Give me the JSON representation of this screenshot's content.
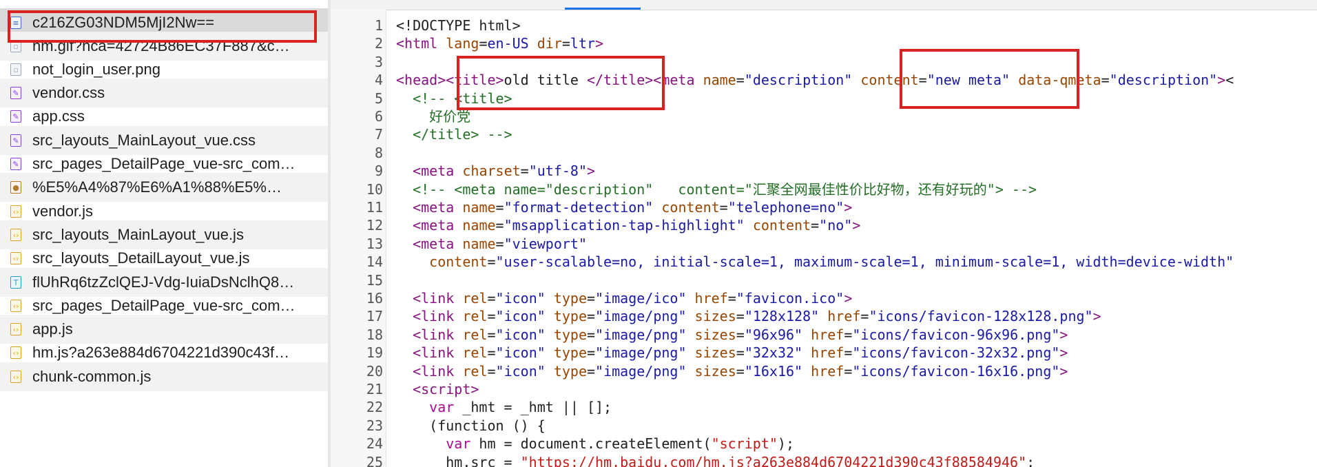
{
  "files": [
    {
      "name": "c216ZG03NDM5MjI2Nw==",
      "icon": "document-icon",
      "selected": true
    },
    {
      "name": "hm.gif?hca=42724B86EC37F887&c…",
      "icon": "image-icon"
    },
    {
      "name": "not_login_user.png",
      "icon": "image-icon"
    },
    {
      "name": "vendor.css",
      "icon": "stylesheet-icon"
    },
    {
      "name": "app.css",
      "icon": "stylesheet-icon"
    },
    {
      "name": "src_layouts_MainLayout_vue.css",
      "icon": "stylesheet-icon"
    },
    {
      "name": "src_pages_DetailPage_vue-src_com…",
      "icon": "stylesheet-icon"
    },
    {
      "name": "%E5%A4%87%E6%A1%88%E5%…",
      "icon": "badge-image-icon"
    },
    {
      "name": "vendor.js",
      "icon": "script-icon"
    },
    {
      "name": "src_layouts_MainLayout_vue.js",
      "icon": "script-icon"
    },
    {
      "name": "src_layouts_DetailLayout_vue.js",
      "icon": "script-icon"
    },
    {
      "name": "flUhRq6tzZclQEJ-Vdg-IuiaDsNclhQ8…",
      "icon": "font-icon"
    },
    {
      "name": "src_pages_DetailPage_vue-src_com…",
      "icon": "script-icon"
    },
    {
      "name": "app.js",
      "icon": "script-icon"
    },
    {
      "name": "hm.js?a263e884d6704221d390c43f…",
      "icon": "script-icon"
    },
    {
      "name": "chunk-common.js",
      "icon": "script-icon"
    }
  ],
  "code_lines": [
    [
      [
        "pl",
        "<!DOCTYPE html>"
      ]
    ],
    [
      [
        "tg",
        "<html"
      ],
      [
        "pl",
        " "
      ],
      [
        "an",
        "lang"
      ],
      [
        "pl",
        "="
      ],
      [
        "av",
        "en-US"
      ],
      [
        "pl",
        " "
      ],
      [
        "an",
        "dir"
      ],
      [
        "pl",
        "="
      ],
      [
        "av",
        "ltr"
      ],
      [
        "tg",
        ">"
      ]
    ],
    [],
    [
      [
        "tg",
        "<head>"
      ],
      [
        "tg",
        "<title>"
      ],
      [
        "pl",
        "old title "
      ],
      [
        "tg",
        "</title>"
      ],
      [
        "tg",
        "<meta"
      ],
      [
        "pl",
        " "
      ],
      [
        "an",
        "name"
      ],
      [
        "pl",
        "="
      ],
      [
        "av",
        "\"description\""
      ],
      [
        "pl",
        " "
      ],
      [
        "an",
        "content"
      ],
      [
        "pl",
        "="
      ],
      [
        "av",
        "\"new meta\""
      ],
      [
        "pl",
        " "
      ],
      [
        "an",
        "data-qmeta"
      ],
      [
        "pl",
        "="
      ],
      [
        "av",
        "\"description\""
      ],
      [
        "tg",
        ">"
      ],
      [
        "pl",
        "<"
      ]
    ],
    [
      [
        "pl",
        "  "
      ],
      [
        "cm",
        "<!-- <title>"
      ]
    ],
    [
      [
        "cm",
        "    好价党"
      ]
    ],
    [
      [
        "cm",
        "  </title> -->"
      ]
    ],
    [],
    [
      [
        "pl",
        "  "
      ],
      [
        "tg",
        "<meta"
      ],
      [
        "pl",
        " "
      ],
      [
        "an",
        "charset"
      ],
      [
        "pl",
        "="
      ],
      [
        "av",
        "\"utf-8\""
      ],
      [
        "tg",
        ">"
      ]
    ],
    [
      [
        "pl",
        "  "
      ],
      [
        "cm",
        "<!-- <meta name=\"description\"   content=\"汇聚全网最佳性价比好物，还有好玩的\"> -->"
      ]
    ],
    [
      [
        "pl",
        "  "
      ],
      [
        "tg",
        "<meta"
      ],
      [
        "pl",
        " "
      ],
      [
        "an",
        "name"
      ],
      [
        "pl",
        "="
      ],
      [
        "av",
        "\"format-detection\""
      ],
      [
        "pl",
        " "
      ],
      [
        "an",
        "content"
      ],
      [
        "pl",
        "="
      ],
      [
        "av",
        "\"telephone=no\""
      ],
      [
        "tg",
        ">"
      ]
    ],
    [
      [
        "pl",
        "  "
      ],
      [
        "tg",
        "<meta"
      ],
      [
        "pl",
        " "
      ],
      [
        "an",
        "name"
      ],
      [
        "pl",
        "="
      ],
      [
        "av",
        "\"msapplication-tap-highlight\""
      ],
      [
        "pl",
        " "
      ],
      [
        "an",
        "content"
      ],
      [
        "pl",
        "="
      ],
      [
        "av",
        "\"no\""
      ],
      [
        "tg",
        ">"
      ]
    ],
    [
      [
        "pl",
        "  "
      ],
      [
        "tg",
        "<meta"
      ],
      [
        "pl",
        " "
      ],
      [
        "an",
        "name"
      ],
      [
        "pl",
        "="
      ],
      [
        "av",
        "\"viewport\""
      ]
    ],
    [
      [
        "pl",
        "    "
      ],
      [
        "an",
        "content"
      ],
      [
        "pl",
        "="
      ],
      [
        "av",
        "\"user-scalable=no, initial-scale=1, maximum-scale=1, minimum-scale=1, width=device-width\""
      ]
    ],
    [],
    [
      [
        "pl",
        "  "
      ],
      [
        "tg",
        "<link"
      ],
      [
        "pl",
        " "
      ],
      [
        "an",
        "rel"
      ],
      [
        "pl",
        "="
      ],
      [
        "av",
        "\"icon\""
      ],
      [
        "pl",
        " "
      ],
      [
        "an",
        "type"
      ],
      [
        "pl",
        "="
      ],
      [
        "av",
        "\"image/ico\""
      ],
      [
        "pl",
        " "
      ],
      [
        "an",
        "href"
      ],
      [
        "pl",
        "="
      ],
      [
        "av",
        "\"favicon.ico\""
      ],
      [
        "tg",
        ">"
      ]
    ],
    [
      [
        "pl",
        "  "
      ],
      [
        "tg",
        "<link"
      ],
      [
        "pl",
        " "
      ],
      [
        "an",
        "rel"
      ],
      [
        "pl",
        "="
      ],
      [
        "av",
        "\"icon\""
      ],
      [
        "pl",
        " "
      ],
      [
        "an",
        "type"
      ],
      [
        "pl",
        "="
      ],
      [
        "av",
        "\"image/png\""
      ],
      [
        "pl",
        " "
      ],
      [
        "an",
        "sizes"
      ],
      [
        "pl",
        "="
      ],
      [
        "av",
        "\"128x128\""
      ],
      [
        "pl",
        " "
      ],
      [
        "an",
        "href"
      ],
      [
        "pl",
        "="
      ],
      [
        "av",
        "\"icons/favicon-128x128.png\""
      ],
      [
        "tg",
        ">"
      ]
    ],
    [
      [
        "pl",
        "  "
      ],
      [
        "tg",
        "<link"
      ],
      [
        "pl",
        " "
      ],
      [
        "an",
        "rel"
      ],
      [
        "pl",
        "="
      ],
      [
        "av",
        "\"icon\""
      ],
      [
        "pl",
        " "
      ],
      [
        "an",
        "type"
      ],
      [
        "pl",
        "="
      ],
      [
        "av",
        "\"image/png\""
      ],
      [
        "pl",
        " "
      ],
      [
        "an",
        "sizes"
      ],
      [
        "pl",
        "="
      ],
      [
        "av",
        "\"96x96\""
      ],
      [
        "pl",
        " "
      ],
      [
        "an",
        "href"
      ],
      [
        "pl",
        "="
      ],
      [
        "av",
        "\"icons/favicon-96x96.png\""
      ],
      [
        "tg",
        ">"
      ]
    ],
    [
      [
        "pl",
        "  "
      ],
      [
        "tg",
        "<link"
      ],
      [
        "pl",
        " "
      ],
      [
        "an",
        "rel"
      ],
      [
        "pl",
        "="
      ],
      [
        "av",
        "\"icon\""
      ],
      [
        "pl",
        " "
      ],
      [
        "an",
        "type"
      ],
      [
        "pl",
        "="
      ],
      [
        "av",
        "\"image/png\""
      ],
      [
        "pl",
        " "
      ],
      [
        "an",
        "sizes"
      ],
      [
        "pl",
        "="
      ],
      [
        "av",
        "\"32x32\""
      ],
      [
        "pl",
        " "
      ],
      [
        "an",
        "href"
      ],
      [
        "pl",
        "="
      ],
      [
        "av",
        "\"icons/favicon-32x32.png\""
      ],
      [
        "tg",
        ">"
      ]
    ],
    [
      [
        "pl",
        "  "
      ],
      [
        "tg",
        "<link"
      ],
      [
        "pl",
        " "
      ],
      [
        "an",
        "rel"
      ],
      [
        "pl",
        "="
      ],
      [
        "av",
        "\"icon\""
      ],
      [
        "pl",
        " "
      ],
      [
        "an",
        "type"
      ],
      [
        "pl",
        "="
      ],
      [
        "av",
        "\"image/png\""
      ],
      [
        "pl",
        " "
      ],
      [
        "an",
        "sizes"
      ],
      [
        "pl",
        "="
      ],
      [
        "av",
        "\"16x16\""
      ],
      [
        "pl",
        " "
      ],
      [
        "an",
        "href"
      ],
      [
        "pl",
        "="
      ],
      [
        "av",
        "\"icons/favicon-16x16.png\""
      ],
      [
        "tg",
        ">"
      ]
    ],
    [
      [
        "pl",
        "  "
      ],
      [
        "tg",
        "<script>"
      ]
    ],
    [
      [
        "pl",
        "    "
      ],
      [
        "kw",
        "var"
      ],
      [
        "pl",
        " _hmt = _hmt || [];"
      ]
    ],
    [
      [
        "pl",
        "    (function () {"
      ]
    ],
    [
      [
        "pl",
        "      "
      ],
      [
        "kw",
        "var"
      ],
      [
        "pl",
        " hm = document.createElement("
      ],
      [
        "st",
        "\"script\""
      ],
      [
        "pl",
        ");"
      ]
    ],
    [
      [
        "pl",
        "      hm.src = "
      ],
      [
        "st",
        "\"https://hm.baidu.com/hm.js?a263e884d6704221d390c43f88584946\""
      ],
      [
        "pl",
        ";"
      ]
    ]
  ]
}
